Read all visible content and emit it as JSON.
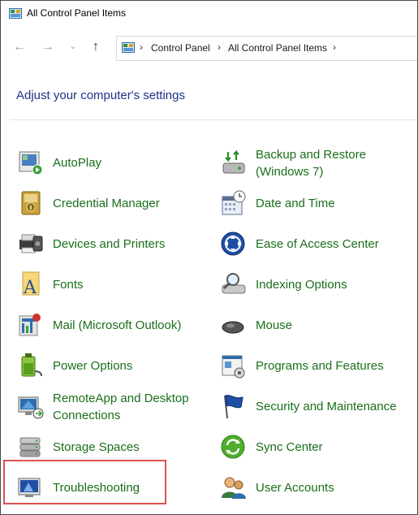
{
  "window": {
    "title": "All Control Panel Items"
  },
  "address": {
    "crumbs": [
      "Control Panel",
      "All Control Panel Items"
    ]
  },
  "heading": "Adjust your computer's settings",
  "items": [
    {
      "label": "AutoPlay",
      "icon": "autoplay-icon"
    },
    {
      "label": "Backup and Restore (Windows 7)",
      "icon": "backup-restore-icon"
    },
    {
      "label": "Credential Manager",
      "icon": "credential-manager-icon"
    },
    {
      "label": "Date and Time",
      "icon": "date-time-icon"
    },
    {
      "label": "Devices and Printers",
      "icon": "devices-printers-icon"
    },
    {
      "label": "Ease of Access Center",
      "icon": "ease-of-access-icon"
    },
    {
      "label": "Fonts",
      "icon": "fonts-icon"
    },
    {
      "label": "Indexing Options",
      "icon": "indexing-options-icon"
    },
    {
      "label": "Mail (Microsoft Outlook)",
      "icon": "mail-icon"
    },
    {
      "label": "Mouse",
      "icon": "mouse-icon"
    },
    {
      "label": "Power Options",
      "icon": "power-options-icon"
    },
    {
      "label": "Programs and Features",
      "icon": "programs-features-icon"
    },
    {
      "label": "RemoteApp and Desktop Connections",
      "icon": "remoteapp-icon"
    },
    {
      "label": "Security and Maintenance",
      "icon": "security-maintenance-icon"
    },
    {
      "label": "Storage Spaces",
      "icon": "storage-spaces-icon"
    },
    {
      "label": "Sync Center",
      "icon": "sync-center-icon"
    },
    {
      "label": "Troubleshooting",
      "icon": "troubleshooting-icon"
    },
    {
      "label": "User Accounts",
      "icon": "user-accounts-icon"
    }
  ],
  "colors": {
    "link": "#1a6e1a",
    "heading": "#1e3287",
    "highlight": "#d9534f"
  }
}
